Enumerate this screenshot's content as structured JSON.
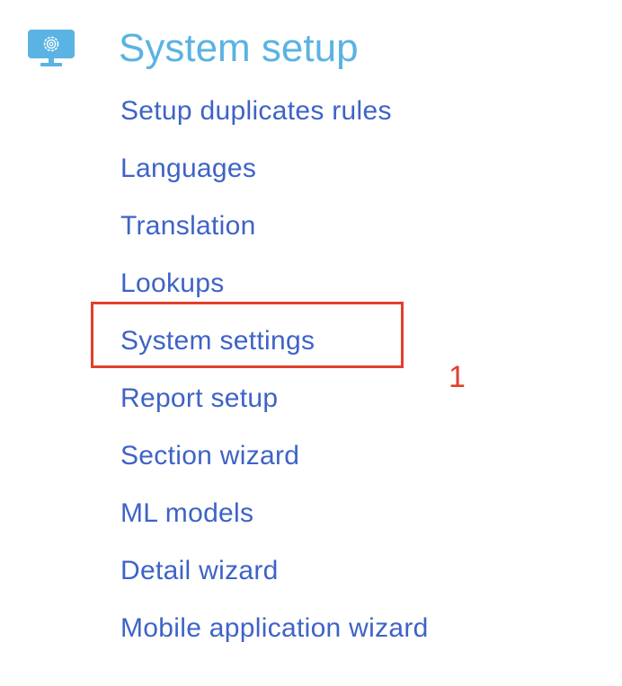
{
  "section": {
    "icon": "monitor-gear-icon",
    "title": "System setup",
    "color": "#5ab3e2"
  },
  "links": [
    {
      "label": "Setup duplicates rules"
    },
    {
      "label": "Languages"
    },
    {
      "label": "Translation"
    },
    {
      "label": "Lookups"
    },
    {
      "label": "System settings"
    },
    {
      "label": "Report setup"
    },
    {
      "label": "Section wizard"
    },
    {
      "label": "ML models"
    },
    {
      "label": "Detail wizard"
    },
    {
      "label": "Mobile application wizard"
    }
  ],
  "link_color": "#3e63c7",
  "annotation": {
    "number": "1",
    "color": "#e0402c"
  }
}
